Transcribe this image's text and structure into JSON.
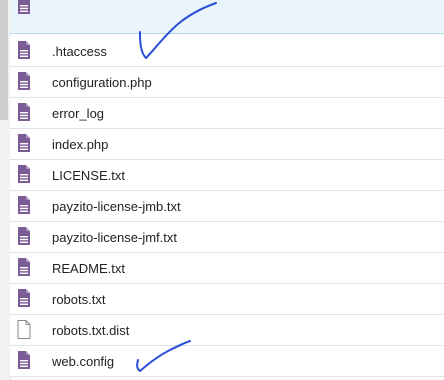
{
  "colors": {
    "doc_icon": "#7b5c97",
    "blank_icon": "#8a8a8a",
    "annotation_ink": "#2b4fd6",
    "top_row_highlight": "#e9f5fa"
  },
  "files": [
    {
      "name": ".htaccess",
      "icon": "document-icon"
    },
    {
      "name": "configuration.php",
      "icon": "document-icon"
    },
    {
      "name": "error_log",
      "icon": "document-icon"
    },
    {
      "name": "index.php",
      "icon": "document-icon"
    },
    {
      "name": "LICENSE.txt",
      "icon": "document-icon"
    },
    {
      "name": "payzito-license-jmb.txt",
      "icon": "document-icon"
    },
    {
      "name": "payzito-license-jmf.txt",
      "icon": "document-icon"
    },
    {
      "name": "README.txt",
      "icon": "document-icon"
    },
    {
      "name": "robots.txt",
      "icon": "document-icon"
    },
    {
      "name": "robots.txt.dist",
      "icon": "blank-file-icon"
    },
    {
      "name": "web.config",
      "icon": "document-icon"
    }
  ],
  "annotations": [
    {
      "name": "checkmark-annotation-htaccess"
    },
    {
      "name": "checkmark-annotation-web-config"
    }
  ]
}
